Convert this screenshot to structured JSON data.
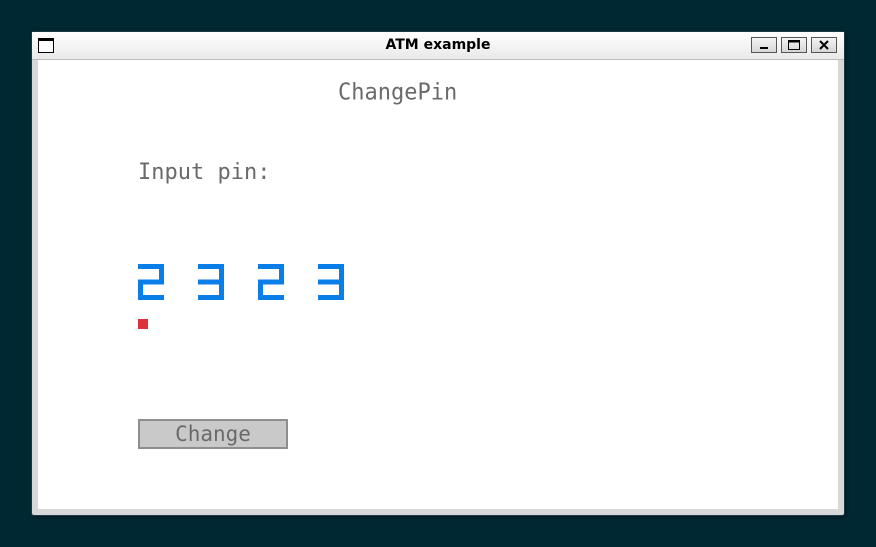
{
  "window": {
    "title": "ATM example"
  },
  "screen": {
    "heading": "ChangePin",
    "prompt": "Input pin:",
    "pin_digits": [
      "2",
      "3",
      "2",
      "3"
    ],
    "change_button_label": "Change"
  },
  "colors": {
    "background": "#002833",
    "digit": "#0a7ee8",
    "cursor": "#e0303a",
    "text": "#6a6a6a",
    "button_fill": "#c9c9c9"
  }
}
